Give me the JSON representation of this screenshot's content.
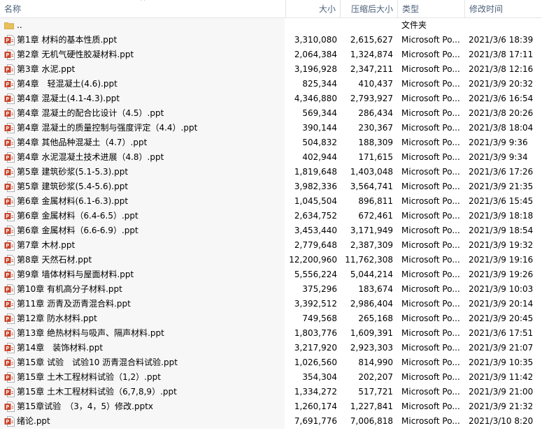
{
  "columns": {
    "name": "名称",
    "size": "大小",
    "compressed": "压缩后大小",
    "type": "类型",
    "modified": "修改时间"
  },
  "sort_indicator": "^",
  "parent": {
    "name": "..",
    "type": "文件夹"
  },
  "files": [
    {
      "name": "第1章 材料的基本性质.ppt",
      "size": "3,310,080",
      "compressed": "2,615,627",
      "type": "Microsoft Po...",
      "modified": "2021/3/6 18:39",
      "icon": "ppt-icon"
    },
    {
      "name": "第2章 无机气硬性胶凝材料.ppt",
      "size": "2,064,384",
      "compressed": "1,324,874",
      "type": "Microsoft Po...",
      "modified": "2021/3/8 17:11",
      "icon": "ppt-icon"
    },
    {
      "name": "第3章 水泥.ppt",
      "size": "3,196,928",
      "compressed": "2,347,211",
      "type": "Microsoft Po...",
      "modified": "2021/3/8 12:16",
      "icon": "ppt-icon"
    },
    {
      "name": "第4章　轻混凝土(4.6).ppt",
      "size": "825,344",
      "compressed": "410,437",
      "type": "Microsoft Po...",
      "modified": "2021/3/9 20:32",
      "icon": "ppt-icon"
    },
    {
      "name": "第4章 混凝土(4.1-4.3).ppt",
      "size": "4,346,880",
      "compressed": "2,793,927",
      "type": "Microsoft Po...",
      "modified": "2021/3/6 16:54",
      "icon": "ppt-icon"
    },
    {
      "name": "第4章 混凝土的配合比设计（4.5）.ppt",
      "size": "569,344",
      "compressed": "286,434",
      "type": "Microsoft Po...",
      "modified": "2021/3/8 20:26",
      "icon": "ppt-icon"
    },
    {
      "name": "第4章 混凝土的质量控制与强度评定（4.4）.ppt",
      "size": "390,144",
      "compressed": "230,367",
      "type": "Microsoft Po...",
      "modified": "2021/3/8 18:04",
      "icon": "ppt-icon"
    },
    {
      "name": "第4章 其他品种混凝土（4.7）.ppt",
      "size": "504,832",
      "compressed": "188,309",
      "type": "Microsoft Po...",
      "modified": "2021/3/9 9:36",
      "icon": "ppt-icon"
    },
    {
      "name": "第4章 水泥混凝土技术进展（4.8）.ppt",
      "size": "402,944",
      "compressed": "171,615",
      "type": "Microsoft Po...",
      "modified": "2021/3/9 9:34",
      "icon": "ppt-icon"
    },
    {
      "name": "第5章 建筑砂浆(5.1-5.3).ppt",
      "size": "1,819,648",
      "compressed": "1,403,048",
      "type": "Microsoft Po...",
      "modified": "2021/3/6 17:26",
      "icon": "ppt-icon"
    },
    {
      "name": "第5章 建筑砂浆(5.4-5.6).ppt",
      "size": "3,982,336",
      "compressed": "3,564,741",
      "type": "Microsoft Po...",
      "modified": "2021/3/9 21:35",
      "icon": "ppt-icon"
    },
    {
      "name": "第6章 金属材料(6.1-6.3).ppt",
      "size": "1,045,504",
      "compressed": "896,811",
      "type": "Microsoft Po...",
      "modified": "2021/3/6 15:45",
      "icon": "ppt-icon"
    },
    {
      "name": "第6章 金属材料（6.4-6.5）.ppt",
      "size": "2,634,752",
      "compressed": "672,461",
      "type": "Microsoft Po...",
      "modified": "2021/3/9 18:18",
      "icon": "ppt-icon"
    },
    {
      "name": "第6章 金属材料（6.6-6.9）.ppt",
      "size": "3,453,440",
      "compressed": "3,171,949",
      "type": "Microsoft Po...",
      "modified": "2021/3/9 18:54",
      "icon": "ppt-icon"
    },
    {
      "name": "第7章 木材.ppt",
      "size": "2,779,648",
      "compressed": "2,387,309",
      "type": "Microsoft Po...",
      "modified": "2021/3/9 19:32",
      "icon": "ppt-icon"
    },
    {
      "name": "第8章 天然石材.ppt",
      "size": "12,200,960",
      "compressed": "11,762,308",
      "type": "Microsoft Po...",
      "modified": "2021/3/9 19:16",
      "icon": "ppt-icon"
    },
    {
      "name": "第9章 墙体材料与屋面材料.ppt",
      "size": "5,556,224",
      "compressed": "5,044,214",
      "type": "Microsoft Po...",
      "modified": "2021/3/9 19:26",
      "icon": "ppt-icon"
    },
    {
      "name": "第10章 有机高分子材料.ppt",
      "size": "375,296",
      "compressed": "183,674",
      "type": "Microsoft Po...",
      "modified": "2021/3/9 10:03",
      "icon": "ppt-icon"
    },
    {
      "name": "第11章 沥青及沥青混合料.ppt",
      "size": "3,392,512",
      "compressed": "2,986,404",
      "type": "Microsoft Po...",
      "modified": "2021/3/9 20:14",
      "icon": "ppt-icon"
    },
    {
      "name": "第12章 防水材料.ppt",
      "size": "749,568",
      "compressed": "265,168",
      "type": "Microsoft Po...",
      "modified": "2021/3/9 20:45",
      "icon": "ppt-icon"
    },
    {
      "name": "第13章 绝热材料与吸声、隔声材料.ppt",
      "size": "1,803,776",
      "compressed": "1,609,391",
      "type": "Microsoft Po...",
      "modified": "2021/3/6 17:51",
      "icon": "ppt-icon"
    },
    {
      "name": "第14章　装饰材料.ppt",
      "size": "3,217,920",
      "compressed": "2,923,303",
      "type": "Microsoft Po...",
      "modified": "2021/3/9 21:07",
      "icon": "ppt-icon"
    },
    {
      "name": "第15章 试验　试验10 沥青混合料试验.ppt",
      "size": "1,026,560",
      "compressed": "814,990",
      "type": "Microsoft Po...",
      "modified": "2021/3/9 10:35",
      "icon": "ppt-icon"
    },
    {
      "name": "第15章 土木工程材料试验（1,2）.ppt",
      "size": "354,304",
      "compressed": "202,207",
      "type": "Microsoft Po...",
      "modified": "2021/3/9 11:42",
      "icon": "ppt-icon"
    },
    {
      "name": "第15章 土木工程材料试验（6,7,8,9）.ppt",
      "size": "1,334,272",
      "compressed": "517,721",
      "type": "Microsoft Po...",
      "modified": "2021/3/9 21:00",
      "icon": "ppt-icon"
    },
    {
      "name": "第15章试验　（3，4，5）修改.pptx",
      "size": "1,260,174",
      "compressed": "1,227,841",
      "type": "Microsoft Po...",
      "modified": "2021/3/9 21:32",
      "icon": "pptx-icon"
    },
    {
      "name": "绪论.ppt",
      "size": "7,691,776",
      "compressed": "7,006,818",
      "type": "Microsoft Po...",
      "modified": "2021/3/10 8:20",
      "icon": "ppt-icon"
    }
  ],
  "colors": {
    "header_text": "#4c607a",
    "name_column_bg": "#f7f7f7",
    "ppt_icon": "#c8452c",
    "folder_icon": "#e8c15a"
  }
}
